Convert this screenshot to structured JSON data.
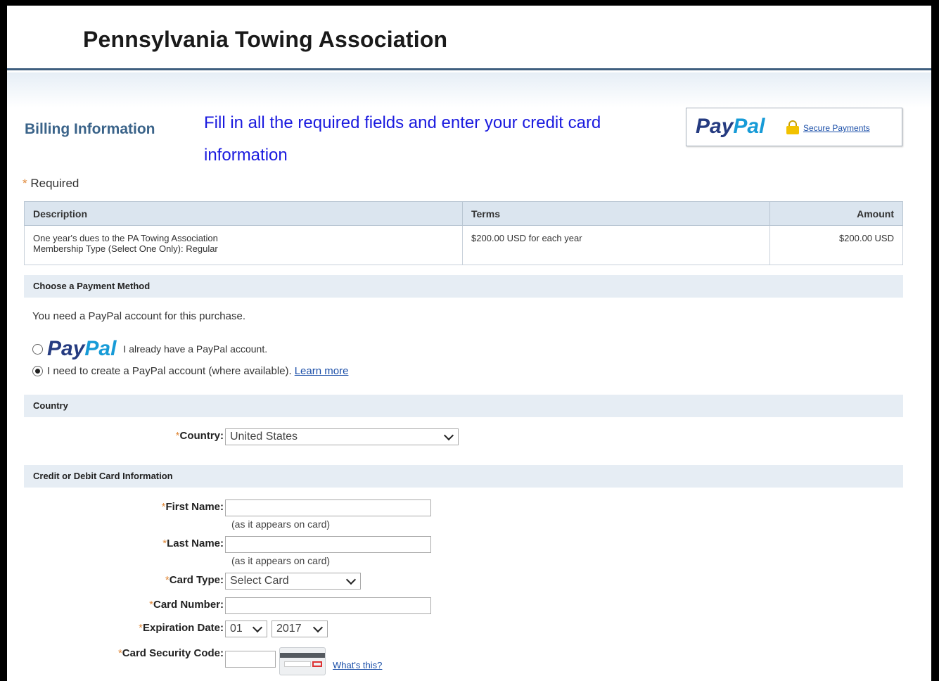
{
  "header": {
    "title": "Pennsylvania Towing Association"
  },
  "billing": {
    "title": "Billing Information",
    "instruction": "Fill in all the required fields and enter your credit card information"
  },
  "paypal_box": {
    "logo_part1": "Pay",
    "logo_part2": "Pal",
    "secure_label": "Secure Payments"
  },
  "required_note": {
    "star": "*",
    "text": "Required"
  },
  "items_table": {
    "headers": {
      "description": "Description",
      "terms": "Terms",
      "amount": "Amount"
    },
    "rows": [
      {
        "description_line1": "One year's dues to the PA Towing Association",
        "description_line2": "Membership Type (Select One Only): Regular",
        "terms": "$200.00 USD for each year",
        "amount": "$200.00 USD"
      }
    ]
  },
  "payment_method": {
    "section_title": "Choose a Payment Method",
    "notice": "You need a PayPal account for this purchase.",
    "option_existing": {
      "logo_part1": "Pay",
      "logo_part2": "Pal",
      "label": "I already have a PayPal account."
    },
    "option_create": {
      "label": "I need to create a PayPal account (where available).",
      "link": "Learn more"
    }
  },
  "country": {
    "section_title": "Country",
    "label": "Country:",
    "selected": "United States"
  },
  "card": {
    "section_title": "Credit or Debit Card Information",
    "first_name_label": "First Name:",
    "first_name_hint": "(as it appears on card)",
    "last_name_label": "Last Name:",
    "last_name_hint": "(as it appears on card)",
    "card_type_label": "Card Type:",
    "card_type_selected": "Select Card",
    "card_number_label": "Card Number:",
    "expiration_label": "Expiration Date:",
    "exp_month": "01",
    "exp_year": "2017",
    "security_label": "Card Security Code:",
    "whats_this": "What's this?"
  },
  "colors": {
    "accent": "#3a6389",
    "instruction": "#1a1adf",
    "link": "#1a4ea8",
    "required": "#e08a3c"
  }
}
